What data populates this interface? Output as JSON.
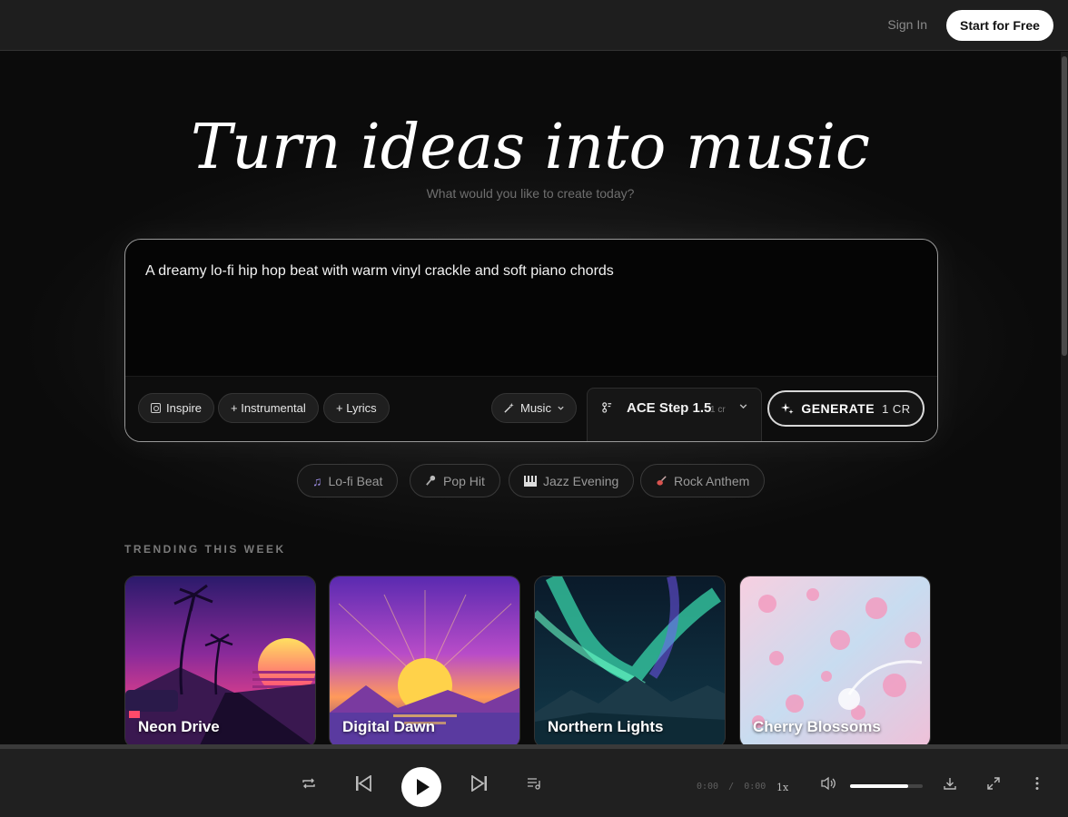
{
  "header": {
    "signin_label": "Sign In",
    "start_label": "Start for Free"
  },
  "hero": {
    "title": "Turn ideas into music",
    "subtitle": "What would you like to create today?"
  },
  "prompt": {
    "text": "A dreamy lo-fi hip hop beat with warm vinyl crackle and soft piano chords",
    "buttons": {
      "inspire": "Inspire",
      "instrumental": "+ Instrumental",
      "lyrics": "+ Lyrics"
    },
    "mode": "Music",
    "model": {
      "name": "ACE Step 1.5",
      "cost": "1 cr"
    },
    "generate": {
      "label": "GENERATE",
      "cost": "1 CR"
    }
  },
  "suggestions": [
    {
      "icon": "music-note-icon",
      "label": "Lo-fi Beat"
    },
    {
      "icon": "microphone-icon",
      "label": "Pop Hit"
    },
    {
      "icon": "piano-icon",
      "label": "Jazz Evening"
    },
    {
      "icon": "guitar-icon",
      "label": "Rock Anthem"
    }
  ],
  "trending": {
    "label": "TRENDING THIS WEEK",
    "cards": [
      {
        "title": "Neon Drive"
      },
      {
        "title": "Digital Dawn"
      },
      {
        "title": "Northern Lights"
      },
      {
        "title": "Cherry Blossoms"
      }
    ]
  },
  "player": {
    "current_time": "0:00",
    "separator": "/",
    "duration": "0:00",
    "speed": "1x",
    "volume": 0.8
  },
  "colors": {
    "background": "#0c0c0c",
    "accent": "#ffffff"
  }
}
